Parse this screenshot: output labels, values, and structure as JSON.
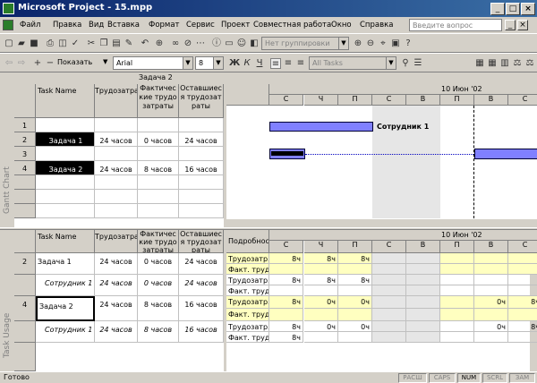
{
  "window": {
    "title": "Microsoft Project - 15.mpp",
    "min": "_",
    "max": "□",
    "close": "×"
  },
  "menu": [
    "Файл",
    "Правка",
    "Вид",
    "Вставка",
    "Формат",
    "Сервис",
    "Проект",
    "Совместная работа",
    "Окно",
    "Справка"
  ],
  "help": {
    "placeholder": "Введите вопрос"
  },
  "toolbar1": {
    "grouping": "Нет группировки"
  },
  "toolbar2": {
    "show_label": "Показать",
    "font": "Arial",
    "size": "8",
    "bold": "Ж",
    "italic": "К",
    "underline": "Ч",
    "filter": "All Tasks"
  },
  "entry": {
    "value": "Задача 2"
  },
  "gantt": {
    "side_label": "Gantt Chart",
    "columns": [
      "Task Name",
      "Трудозатраты",
      "Фактические трудозатраты",
      "Оставшиеся трудозатраты"
    ],
    "rows": [
      {
        "num": "1",
        "name": "",
        "work": "",
        "actual": "",
        "remaining": ""
      },
      {
        "num": "2",
        "name": "Задача 1",
        "work": "24 часов",
        "actual": "0 часов",
        "remaining": "24 часов"
      },
      {
        "num": "3",
        "name": "",
        "work": "",
        "actual": "",
        "remaining": ""
      },
      {
        "num": "4",
        "name": "Задача 2",
        "work": "24 часов",
        "actual": "8 часов",
        "remaining": "16 часов"
      }
    ],
    "week_label": "10 Июн '02",
    "days": [
      "С",
      "Ч",
      "П",
      "С",
      "В",
      "П",
      "В",
      "С"
    ],
    "resource_label": "Сотрудник 1"
  },
  "usage": {
    "side_label": "Task Usage",
    "columns": [
      "Task Name",
      "Трудозатраты",
      "Фактические трудозатраты",
      "Оставшиеся трудозатраты"
    ],
    "details_header": "Подробности",
    "week_label": "10 Июн '02",
    "days": [
      "С",
      "Ч",
      "П",
      "С",
      "В",
      "П",
      "В",
      "С"
    ],
    "rows": [
      {
        "num": "2",
        "name": "Задача 1",
        "work": "24 часов",
        "actual": "0 часов",
        "remaining": "24 часов",
        "italic": false
      },
      {
        "num": "",
        "name": "Сотрудник 1",
        "work": "24 часов",
        "actual": "0 часов",
        "remaining": "24 часов",
        "italic": true
      },
      {
        "num": "4",
        "name": "Задача 2",
        "work": "24 часов",
        "actual": "8 часов",
        "remaining": "16 часов",
        "italic": false
      },
      {
        "num": "",
        "name": "Сотрудник 1",
        "work": "24 часов",
        "actual": "8 часов",
        "remaining": "16 часов",
        "italic": true
      }
    ],
    "detail_labels": [
      "Трудозатр.",
      "Факт. труд.",
      "Трудозатр.",
      "Факт. труд.",
      "Трудозатр.",
      "Факт. труд.",
      "Трудозатр.",
      "Факт. труд."
    ],
    "detail_values": [
      [
        "8ч",
        "8ч",
        "8ч",
        "",
        "",
        "",
        "",
        ""
      ],
      [
        "",
        "",
        "",
        "",
        "",
        "",
        "",
        ""
      ],
      [
        "8ч",
        "8ч",
        "8ч",
        "",
        "",
        "",
        "",
        ""
      ],
      [
        "",
        "",
        "",
        "",
        "",
        "",
        "",
        ""
      ],
      [
        "8ч",
        "0ч",
        "0ч",
        "",
        "",
        "",
        "0ч",
        "8ч"
      ],
      [
        "",
        "",
        "",
        "",
        "",
        "",
        "",
        ""
      ],
      [
        "8ч",
        "0ч",
        "0ч",
        "",
        "",
        "",
        "0ч",
        "8ч"
      ],
      [
        "8ч",
        "",
        "",
        "",
        "",
        "",
        "",
        ""
      ]
    ]
  },
  "status": {
    "ready": "Готово",
    "indicators": [
      "РАСШ",
      "CAPS",
      "NUM",
      "SCRL",
      "ЗАМ"
    ]
  },
  "colors": {
    "bar": "#8080ff",
    "title_start": "#0a246a",
    "highlight": "#ffffc0"
  }
}
